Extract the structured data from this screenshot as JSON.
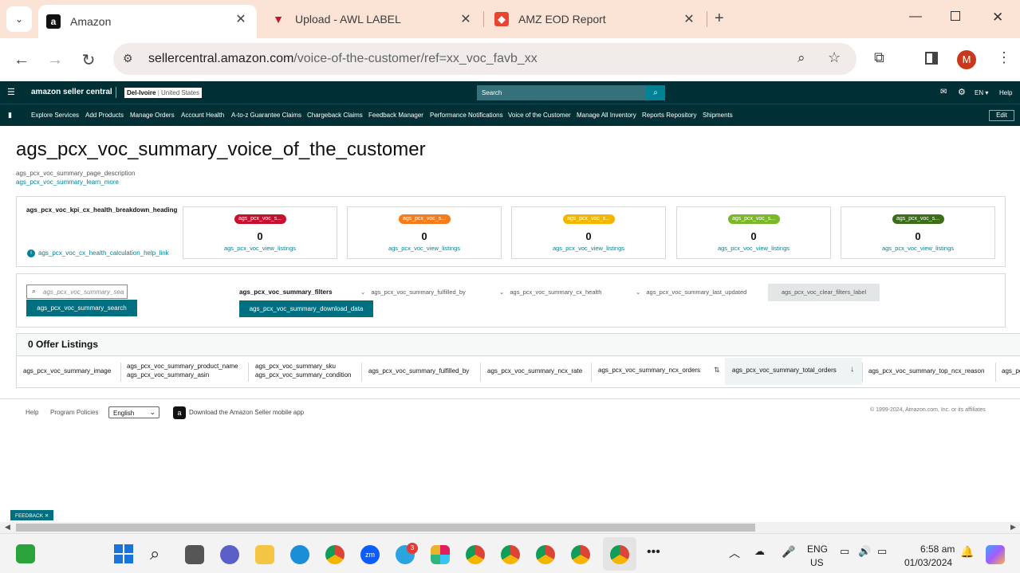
{
  "browser": {
    "tabs": [
      {
        "title": "Amazon",
        "favicon": "amazon-icon"
      },
      {
        "title": "Upload - AWL LABEL",
        "favicon": "awl-icon"
      },
      {
        "title": "AMZ EOD Report",
        "favicon": "report-icon"
      }
    ],
    "url_host": "sellercentral.amazon.com",
    "url_path": "/voice-of-the-customer/ref=xx_voc_favb_xx",
    "profile_initial": "M"
  },
  "header": {
    "logo": "amazon seller central",
    "account_name": "Del-Ivoire",
    "account_region": "United States",
    "search_placeholder": "Search",
    "language": "EN",
    "help": "Help"
  },
  "nav": {
    "items": [
      "Explore Services",
      "Add Products",
      "Manage Orders",
      "Account Health",
      "A-to-z Guarantee Claims",
      "Chargeback Claims",
      "Feedback Manager",
      "Performance Notifications",
      "Voice of the Customer",
      "Manage All Inventory",
      "Reports Repository",
      "Shipments"
    ],
    "edit": "Edit"
  },
  "page": {
    "title": "ags_pcx_voc_summary_voice_of_the_customer",
    "description": "ags_pcx_voc_summary_page_description",
    "learn_more": "ags_pcx_voc_summary_learn_more"
  },
  "kpi": {
    "heading": "ags_pcx_voc_kpi_cx_health_breakdown_heading",
    "help_link": "ags_pcx_voc_cx_health_calculation_help_link",
    "cards": [
      {
        "label": "ags_pcx_voc_s...",
        "count": "0",
        "link": "ags_pcx_voc_view_listings",
        "color": "#c7102e"
      },
      {
        "label": "ags_pcx_voc_s...",
        "count": "0",
        "link": "ags_pcx_voc_view_listings",
        "color": "#f47c1c"
      },
      {
        "label": "ags_pcx_voc_s...",
        "count": "0",
        "link": "ags_pcx_voc_view_listings",
        "color": "#f2b600"
      },
      {
        "label": "ags_pcx_voc_s...",
        "count": "0",
        "link": "ags_pcx_voc_view_listings",
        "color": "#7ab72b"
      },
      {
        "label": "ags_pcx_voc_s...",
        "count": "0",
        "link": "ags_pcx_voc_view_listings",
        "color": "#3c6e1a"
      }
    ]
  },
  "filters": {
    "search_placeholder": "ags_pcx_voc_summary_sea",
    "search_button": "ags_pcx_voc_summary_search",
    "filters_label": "ags_pcx_voc_summary_filters",
    "download_button": "ags_pcx_voc_summary_download_data",
    "fulfilled_by": "ags_pcx_voc_summary_fulfilled_by",
    "cx_health": "ags_pcx_voc_summary_cx_health",
    "last_updated": "ags_pcx_voc_summary_last_updated",
    "clear": "ags_pcx_voc_clear_filters_label"
  },
  "listings": {
    "count_label": "0 Offer Listings",
    "columns": {
      "image": "ags_pcx_voc_summary_image",
      "product_name": "ags_pcx_voc_summary_product_name",
      "asin": "ags_pcx_voc_summary_asin",
      "sku": "ags_pcx_voc_summary_sku",
      "condition": "ags_pcx_voc_summary_condition",
      "fulfilled_by": "ags_pcx_voc_summary_fulfilled_by",
      "ncx_rate": "ags_pcx_voc_summary_ncx_rate",
      "ncx_orders": "ags_pcx_voc_summary_ncx_orders",
      "total_orders": "ags_pcx_voc_summary_total_orders",
      "top_ncx_reason": "ags_pcx_voc_summary_top_ncx_reason",
      "more": "ags_pc"
    }
  },
  "footer": {
    "help": "Help",
    "program_policies": "Program Policies",
    "language": "English",
    "app": "Download the Amazon Seller mobile app",
    "copyright": "© 1999-2024, Amazon.com, Inc. or its affiliates"
  },
  "feedback": "FEEDBACK",
  "taskbar": {
    "lang": "ENG",
    "region": "US",
    "time": "6:58 am",
    "date": "01/03/2024",
    "telegram_badge": "3"
  }
}
